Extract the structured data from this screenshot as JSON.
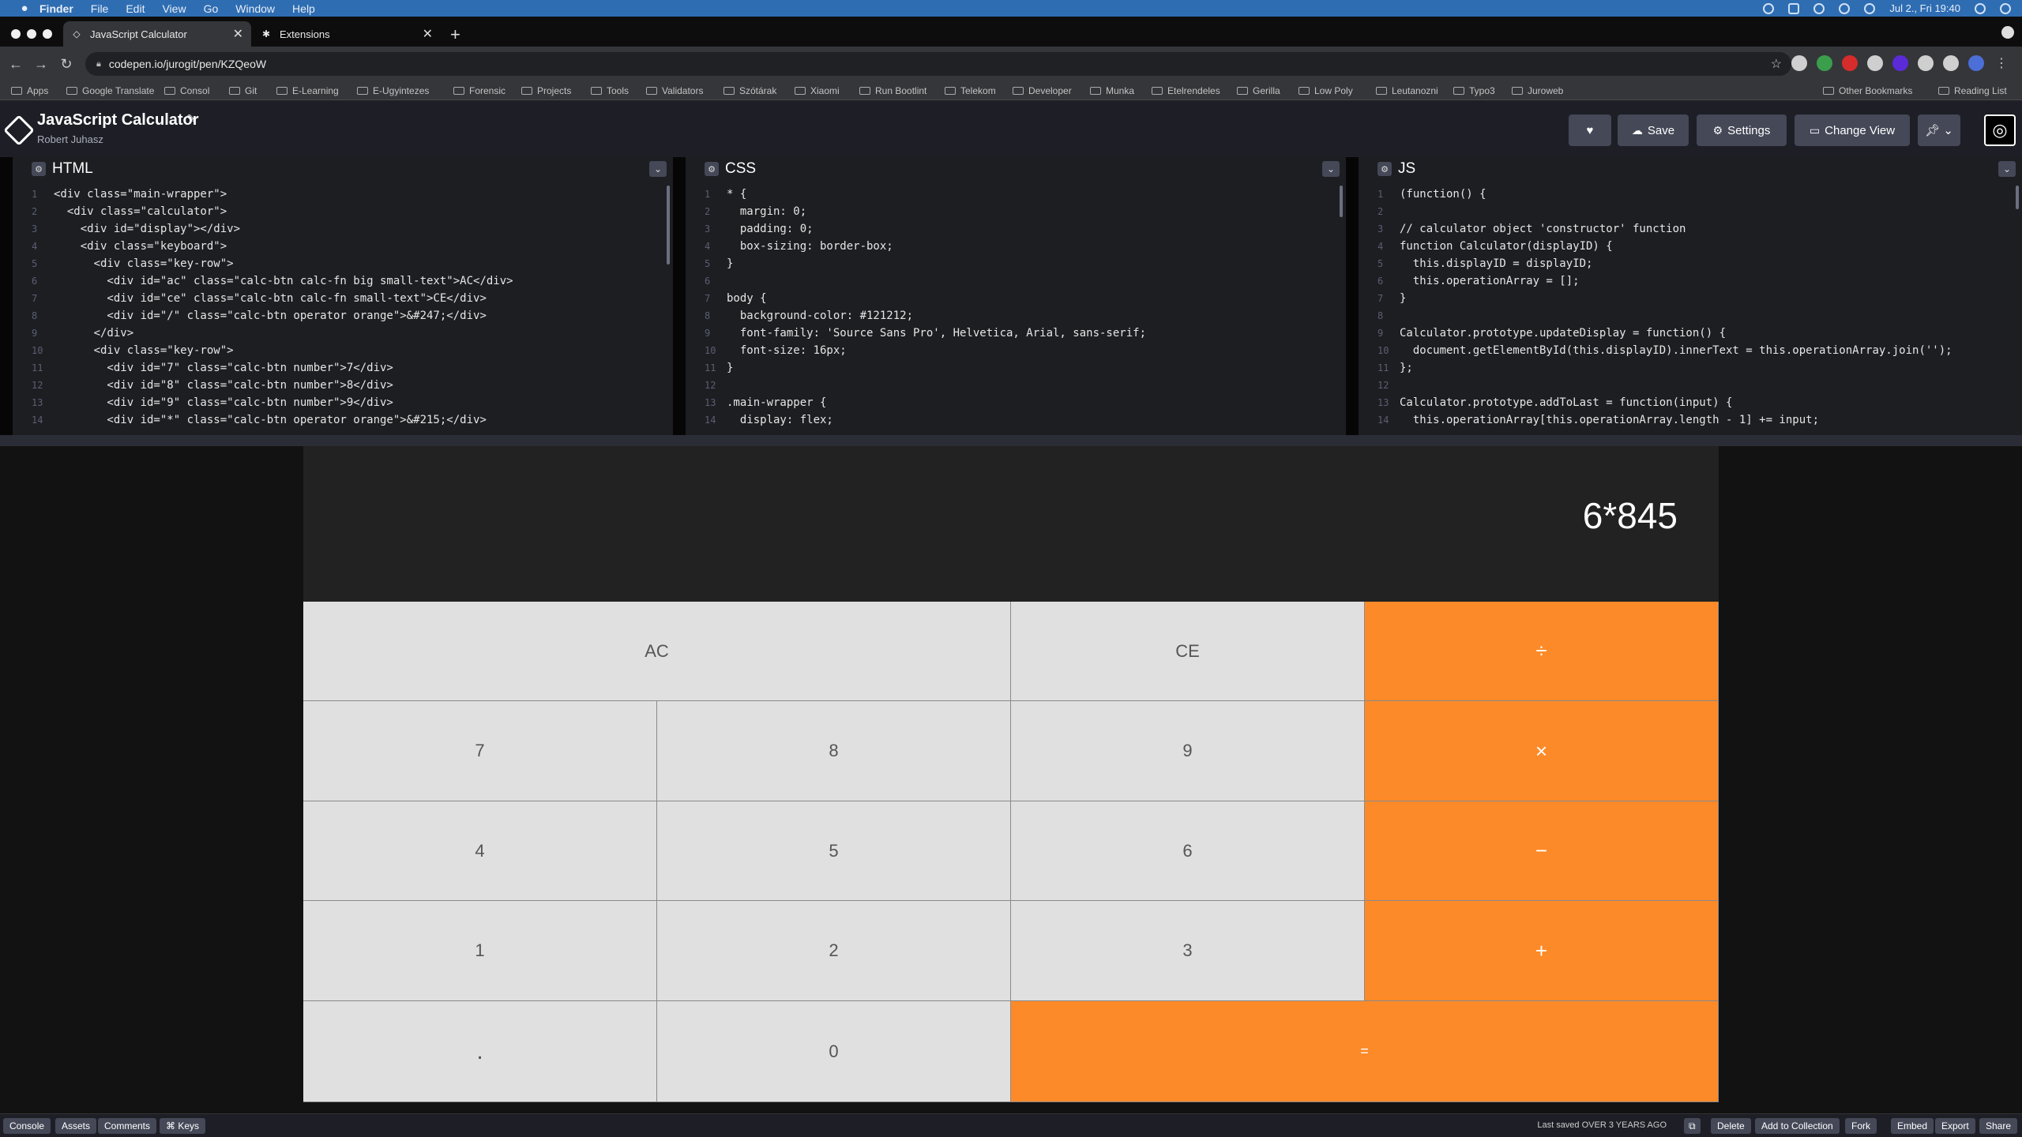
{
  "menubar": {
    "items": [
      "Finder",
      "File",
      "Edit",
      "View",
      "Go",
      "Window",
      "Help"
    ],
    "clock": "Jul 2., Fri 19:40"
  },
  "browser": {
    "tabs": [
      {
        "title": "JavaScript Calculator",
        "icon": "codepen-icon"
      },
      {
        "title": "Extensions",
        "icon": "puzzle-icon"
      }
    ],
    "url": "codepen.io/jurogit/pen/KZQeoW",
    "bookmarks": [
      "Apps",
      "Google Translate",
      "Consol",
      "Git",
      "E-Learning",
      "E-Ugyintezes",
      "Forensic",
      "Projects",
      "Tools",
      "Validators",
      "Szótárak",
      "Xiaomi",
      "Run Bootlint",
      "Telekom",
      "Developer",
      "Munka",
      "Etelrendeles",
      "Gerilla",
      "Low Poly",
      "Leutanozni",
      "Typo3",
      "Juroweb"
    ],
    "other_bookmarks": "Other Bookmarks",
    "reading_list": "Reading List"
  },
  "codepen": {
    "title": "JavaScript Calculator",
    "author": "Robert Juhasz",
    "buttons": {
      "save": "Save",
      "settings": "Settings",
      "change_view": "Change View"
    }
  },
  "editors": {
    "html": {
      "label": "HTML",
      "lines": [
        "<div class=\"main-wrapper\">",
        "  <div class=\"calculator\">",
        "    <div id=\"display\"></div>",
        "    <div class=\"keyboard\">",
        "      <div class=\"key-row\">",
        "        <div id=\"ac\" class=\"calc-btn calc-fn big small-text\">AC</div>",
        "        <div id=\"ce\" class=\"calc-btn calc-fn small-text\">CE</div>",
        "        <div id=\"/\" class=\"calc-btn operator orange\">&#247;</div>",
        "      </div>",
        "      <div class=\"key-row\">",
        "        <div id=\"7\" class=\"calc-btn number\">7</div>",
        "        <div id=\"8\" class=\"calc-btn number\">8</div>",
        "        <div id=\"9\" class=\"calc-btn number\">9</div>",
        "        <div id=\"*\" class=\"calc-btn operator orange\">&#215;</div>"
      ]
    },
    "css": {
      "label": "CSS",
      "lines": [
        "* {",
        "  margin: 0;",
        "  padding: 0;",
        "  box-sizing: border-box;",
        "}",
        "",
        "body {",
        "  background-color: #121212;",
        "  font-family: 'Source Sans Pro', Helvetica, Arial, sans-serif;",
        "  font-size: 16px;",
        "}",
        "",
        ".main-wrapper {",
        "  display: flex;"
      ]
    },
    "js": {
      "label": "JS",
      "lines": [
        "(function() {",
        "",
        "// calculator object 'constructor' function",
        "function Calculator(displayID) {",
        "  this.displayID = displayID;",
        "  this.operationArray = [];",
        "}",
        "",
        "Calculator.prototype.updateDisplay = function() {",
        "  document.getElementById(this.displayID).innerText = this.operationArray.join('');",
        "};",
        "",
        "Calculator.prototype.addToLast = function(input) {",
        "  this.operationArray[this.operationArray.length - 1] += input;"
      ]
    }
  },
  "calculator": {
    "display": "6*845",
    "keys": {
      "ac": "AC",
      "ce": "CE",
      "divide": "÷",
      "k7": "7",
      "k8": "8",
      "k9": "9",
      "multiply": "×",
      "k4": "4",
      "k5": "5",
      "k6": "6",
      "minus": "−",
      "k1": "1",
      "k2": "2",
      "k3": "3",
      "plus": "+",
      "dot": ".",
      "k0": "0",
      "equals": "="
    },
    "colors": {
      "operator": "#fd8a28",
      "key": "#e0e0e0",
      "display_bg": "#222222"
    }
  },
  "footer": {
    "left": [
      "Console",
      "Assets",
      "Comments",
      "⌘ Keys"
    ],
    "last_saved": "Last saved OVER 3 YEARS AGO",
    "right": [
      "Delete",
      "Add to Collection",
      "Fork",
      "Embed",
      "Export",
      "Share"
    ]
  }
}
